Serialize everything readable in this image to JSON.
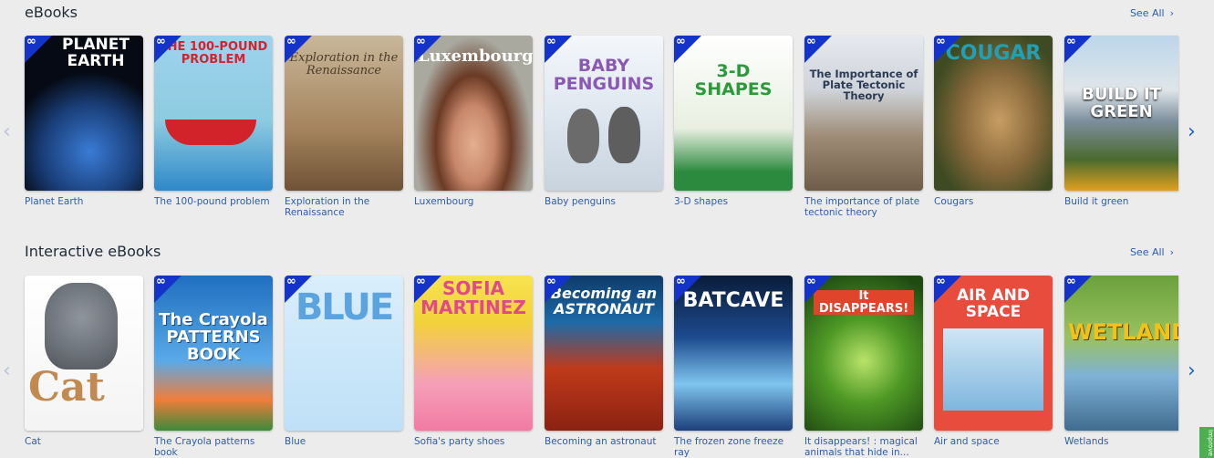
{
  "sections": [
    {
      "title": "eBooks",
      "see_all": "See All",
      "books": [
        {
          "caption": "Planet Earth",
          "cover_text": "PLANET EARTH"
        },
        {
          "caption": "The 100-pound problem",
          "cover_text": "THE 100-POUND PROBLEM"
        },
        {
          "caption": "Exploration in the Renaissance",
          "cover_text": "Exploration in the Renaissance"
        },
        {
          "caption": "Luxembourg",
          "cover_text": "Luxembourg"
        },
        {
          "caption": "Baby penguins",
          "cover_text": "BABY PENGUINS"
        },
        {
          "caption": "3-D shapes",
          "cover_text": "3-D SHAPES"
        },
        {
          "caption": "The importance of plate tectonic theory",
          "cover_text": "The Importance of Plate Tectonic Theory"
        },
        {
          "caption": "Cougars",
          "cover_text": "COUGAR"
        },
        {
          "caption": "Build it green",
          "cover_text": "BUILD IT GREEN"
        }
      ]
    },
    {
      "title": "Interactive eBooks",
      "see_all": "See All",
      "books": [
        {
          "caption": "Cat",
          "cover_text": "Cat"
        },
        {
          "caption": "The Crayola patterns book",
          "cover_text": "The Crayola PATTERNS BOOK"
        },
        {
          "caption": "Blue",
          "cover_text": "BLUE"
        },
        {
          "caption": "Sofia's party shoes",
          "cover_text": "SOFIA MARTINEZ"
        },
        {
          "caption": "Becoming an astronaut",
          "cover_text": "Becoming an ASTRONAUT"
        },
        {
          "caption": "The frozen zone freeze ray",
          "cover_text": "BATCAVE"
        },
        {
          "caption": "It disappears! : magical animals that hide in...",
          "cover_text": "It DISAPPEARS!"
        },
        {
          "caption": "Air and space",
          "cover_text": "AIR AND SPACE"
        },
        {
          "caption": "Wetlands",
          "cover_text": "WETLANDS"
        }
      ]
    }
  ],
  "badge_icon": "infinity-icon",
  "side_tab": "Improve"
}
